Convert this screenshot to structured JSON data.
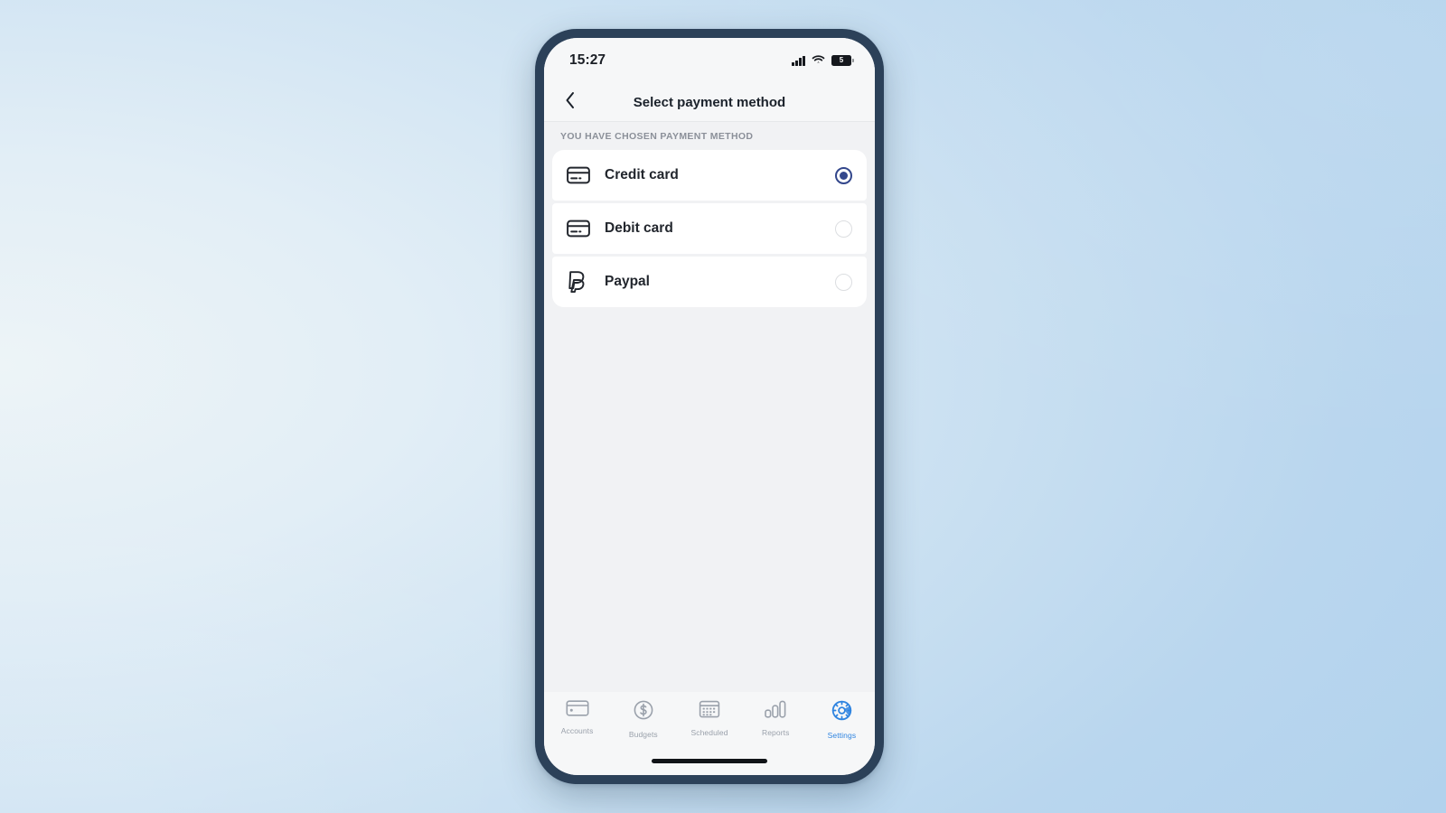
{
  "device": {
    "bezel_color": "#2c4159",
    "background_color": "#bcd9ef"
  },
  "status_bar": {
    "time": "15:27",
    "signal_icon": "cellular-signal-icon",
    "wifi_icon": "wifi-icon",
    "battery_icon": "battery-icon",
    "battery_level": "5"
  },
  "nav_bar": {
    "back_icon": "chevron-left-icon",
    "title": "Select payment method"
  },
  "main": {
    "section_header": "YOU HAVE CHOSEN PAYMENT METHOD",
    "options": [
      {
        "id": "credit-card",
        "label": "Credit card",
        "icon": "credit-card-icon",
        "selected": true
      },
      {
        "id": "debit-card",
        "label": "Debit card",
        "icon": "credit-card-icon",
        "selected": false
      },
      {
        "id": "paypal",
        "label": "Paypal",
        "icon": "paypal-icon",
        "selected": false
      }
    ],
    "selected_color": "#33478c",
    "unselected_color": "#dcdee1"
  },
  "tab_bar": {
    "active_color": "#2f84e0",
    "inactive_color": "#9aa1ab",
    "tabs": [
      {
        "id": "accounts",
        "label": "Accounts",
        "icon": "credit-card-icon",
        "active": false
      },
      {
        "id": "budgets",
        "label": "Budgets",
        "icon": "dollar-circle-icon",
        "active": false
      },
      {
        "id": "scheduled",
        "label": "Scheduled",
        "icon": "calendar-icon",
        "active": false
      },
      {
        "id": "reports",
        "label": "Reports",
        "icon": "bar-chart-icon",
        "active": false
      },
      {
        "id": "settings",
        "label": "Settings",
        "icon": "gear-icon",
        "active": true
      }
    ]
  }
}
